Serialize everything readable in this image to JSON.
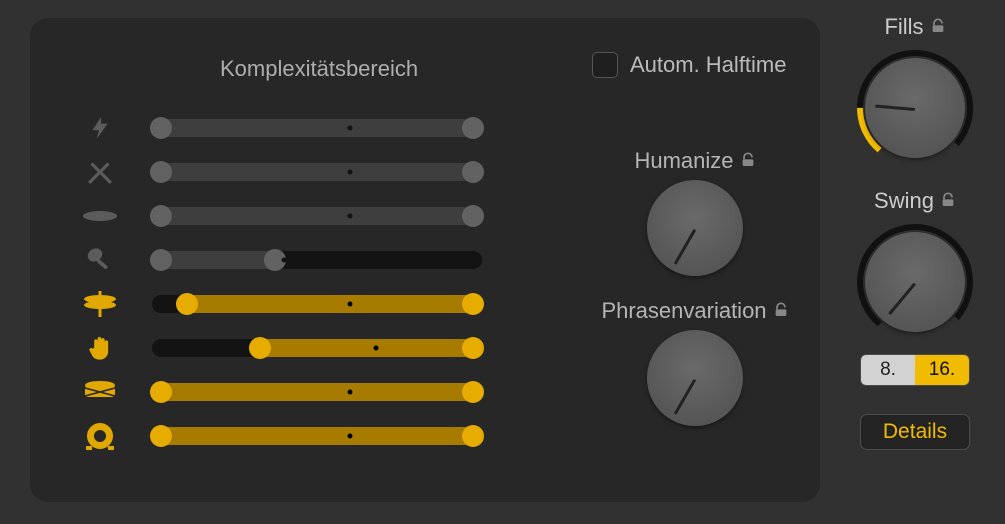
{
  "title": "Komplexitätsbereich",
  "halftime": {
    "label": "Autom. Halftime",
    "checked": false
  },
  "rows": [
    {
      "icon": "lightning",
      "active": false,
      "start": 0,
      "end": 100,
      "dot": 60,
      "partial": false
    },
    {
      "icon": "drumsticks",
      "active": false,
      "start": 0,
      "end": 100,
      "dot": 60,
      "partial": false
    },
    {
      "icon": "cymbal",
      "active": false,
      "start": 0,
      "end": 100,
      "dot": 60,
      "partial": false
    },
    {
      "icon": "shaker",
      "active": false,
      "start": 0,
      "end": 40,
      "dot": 40,
      "partial": true
    },
    {
      "icon": "hihat",
      "active": true,
      "start": 8,
      "end": 100,
      "dot": 60,
      "partial": false
    },
    {
      "icon": "hand",
      "active": true,
      "start": 30,
      "end": 100,
      "dot": 68,
      "partial": false
    },
    {
      "icon": "snare",
      "active": true,
      "start": 0,
      "end": 100,
      "dot": 60,
      "partial": false
    },
    {
      "icon": "kick",
      "active": true,
      "start": 0,
      "end": 100,
      "dot": 60,
      "partial": false
    }
  ],
  "knobs": {
    "humanize": {
      "label": "Humanize",
      "locked": true,
      "angle": 120
    },
    "phrasevariation": {
      "label": "Phrasenvariation",
      "locked": true,
      "angle": 120
    }
  },
  "side": {
    "fills": {
      "label": "Fills",
      "locked": true,
      "angle": 185,
      "arc_percent": 18
    },
    "swing": {
      "label": "Swing",
      "locked": true,
      "angle": 130,
      "seg_a": "8.",
      "seg_b": "16."
    }
  },
  "details_label": "Details"
}
